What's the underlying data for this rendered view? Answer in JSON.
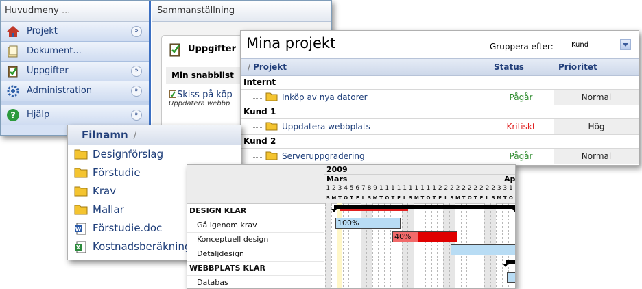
{
  "nav": {
    "header": "Huvudmeny",
    "header_suffix": "...",
    "items": [
      {
        "label": "Projekt",
        "icon": "house-icon",
        "expandable": true
      },
      {
        "label": "Dokument...",
        "icon": "document-icon",
        "expandable": false
      },
      {
        "label": "Uppgifter",
        "icon": "clipboard-check-icon",
        "expandable": true
      },
      {
        "label": "Administration",
        "icon": "gear-icon",
        "expandable": true
      },
      {
        "label": "Hjälp",
        "icon": "help-icon",
        "expandable": true
      }
    ]
  },
  "summary": {
    "header": "Sammanställning",
    "tasks_title": "Uppgifter",
    "quicklist_title": "Min snabblist",
    "task_link": "Skiss på köp",
    "task_sub": "Uppdatera webbp"
  },
  "projects": {
    "title": "Mina projekt",
    "group_by_label": "Gruppera efter:",
    "group_by_value": "Kund",
    "sort_marker": "/",
    "columns": {
      "project": "Projekt",
      "status": "Status",
      "priority": "Prioritet"
    },
    "groups": [
      {
        "name": "Internt",
        "rows": [
          {
            "project": "Inköp av nya datorer",
            "status": "Pågår",
            "status_type": "ok",
            "priority": "Normal"
          }
        ]
      },
      {
        "name": "Kund 1",
        "rows": [
          {
            "project": "Uppdatera webbplats",
            "status": "Kritiskt",
            "status_type": "critical",
            "priority": "Hög"
          }
        ]
      },
      {
        "name": "Kund 2",
        "rows": [
          {
            "project": "Serveruppgradering",
            "status": "Pågår",
            "status_type": "ok",
            "priority": "Normal"
          }
        ]
      }
    ],
    "colors": {
      "status_ok": "#2c8a2c",
      "status_critical": "#e02020",
      "header_text": "#223f7a"
    }
  },
  "files": {
    "header": "Filnamn",
    "sort_marker": "/",
    "items": [
      {
        "name": "Designförslag",
        "type": "folder"
      },
      {
        "name": "Förstudie",
        "type": "folder"
      },
      {
        "name": "Krav",
        "type": "folder"
      },
      {
        "name": "Mallar",
        "type": "folder"
      },
      {
        "name": "Förstudie.doc",
        "type": "word"
      },
      {
        "name": "Kostnadsberäkning",
        "type": "excel"
      }
    ]
  },
  "gantt": {
    "year": "2009",
    "month": "Mars",
    "next_month": "Ap",
    "days": [
      "1",
      "2",
      "3",
      "4",
      "5",
      "6",
      "7",
      "8",
      "9",
      "1",
      "1",
      "1",
      "1",
      "1",
      "1",
      "1",
      "1",
      "1",
      "1",
      "2",
      "2",
      "2",
      "2",
      "2",
      "2",
      "2",
      "2",
      "2",
      "2",
      "3",
      "3",
      "1",
      "2"
    ],
    "weekdays": [
      "S",
      "M",
      "T",
      "O",
      "T",
      "F",
      "L",
      "S",
      "M",
      "T",
      "O",
      "T",
      "F",
      "L",
      "S",
      "M",
      "T",
      "O",
      "T",
      "F",
      "L",
      "S",
      "M",
      "T",
      "O",
      "T",
      "F",
      "L",
      "S",
      "M",
      "T",
      "O",
      "T"
    ],
    "rows": [
      {
        "label": "DESIGN KLAR",
        "kind": "summary"
      },
      {
        "label": "Gå igenom krav",
        "kind": "task",
        "progress_label": "100%",
        "progress": 1.0
      },
      {
        "label": "Konceptuell design",
        "kind": "task",
        "progress_label": "40%",
        "progress": 0.4
      },
      {
        "label": "Detaljdesign",
        "kind": "task"
      },
      {
        "label": "WEBBPLATS KLAR",
        "kind": "summary"
      },
      {
        "label": "Databas",
        "kind": "task"
      }
    ]
  }
}
